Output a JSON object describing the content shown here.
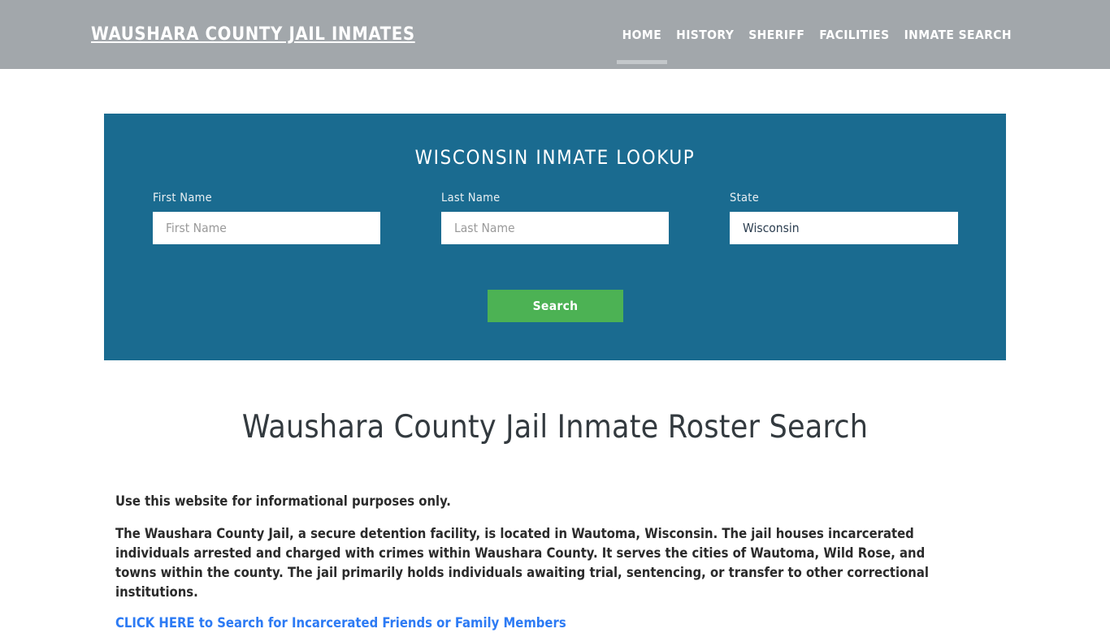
{
  "header": {
    "brand": "Waushara County Jail Inmates",
    "nav": [
      {
        "label": "HOME",
        "active": true
      },
      {
        "label": "HISTORY",
        "active": false
      },
      {
        "label": "SHERIFF",
        "active": false
      },
      {
        "label": "FACILITIES",
        "active": false
      },
      {
        "label": "INMATE SEARCH",
        "active": false
      }
    ]
  },
  "lookup": {
    "title": "WISCONSIN INMATE LOOKUP",
    "fields": {
      "first": {
        "label": "First Name",
        "placeholder": "First Name",
        "value": ""
      },
      "last": {
        "label": "Last Name",
        "placeholder": "Last Name",
        "value": ""
      },
      "state": {
        "label": "State",
        "value": "Wisconsin"
      }
    },
    "submit_label": "Search"
  },
  "main": {
    "heading": "Waushara County Jail Inmate Roster Search",
    "disclaimer": "Use this website for informational purposes only.",
    "description": "The Waushara County Jail, a secure detention facility, is located in Wautoma, Wisconsin. The jail houses incarcerated individuals arrested and charged with crimes within Waushara County. It serves the cities of Wautoma, Wild Rose, and towns within the county. The jail primarily holds individuals awaiting trial, sentencing, or transfer to other correctional institutions.",
    "cta_link": "CLICK HERE to Search for Incarcerated Friends or Family Members"
  },
  "colors": {
    "header_bg": "#a2a7ab",
    "panel_bg": "#1a6b90",
    "button_bg": "#4cb254",
    "link": "#2d7bf4",
    "heading": "#333a3f"
  }
}
